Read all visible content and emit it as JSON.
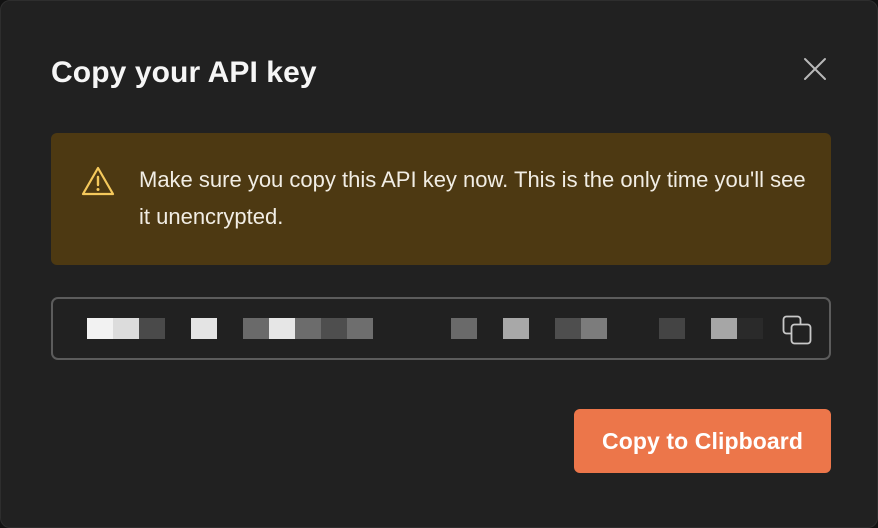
{
  "dialog": {
    "title": "Copy your API key",
    "close_icon": "close-icon",
    "warning": {
      "icon": "warning-triangle-icon",
      "text": "Make sure you copy this API key now. This is the only time you'll see it unencrypted."
    },
    "api_key_field": {
      "value": "",
      "masked": true,
      "copy_icon": "copy-icon"
    },
    "copy_button_label": "Copy to Clipboard"
  },
  "colors": {
    "modal_bg": "#212121",
    "warning_bg": "#4d3912",
    "warning_icon": "#f5c95c",
    "accent": "#ec764a",
    "field_border": "#5c5c5c"
  }
}
